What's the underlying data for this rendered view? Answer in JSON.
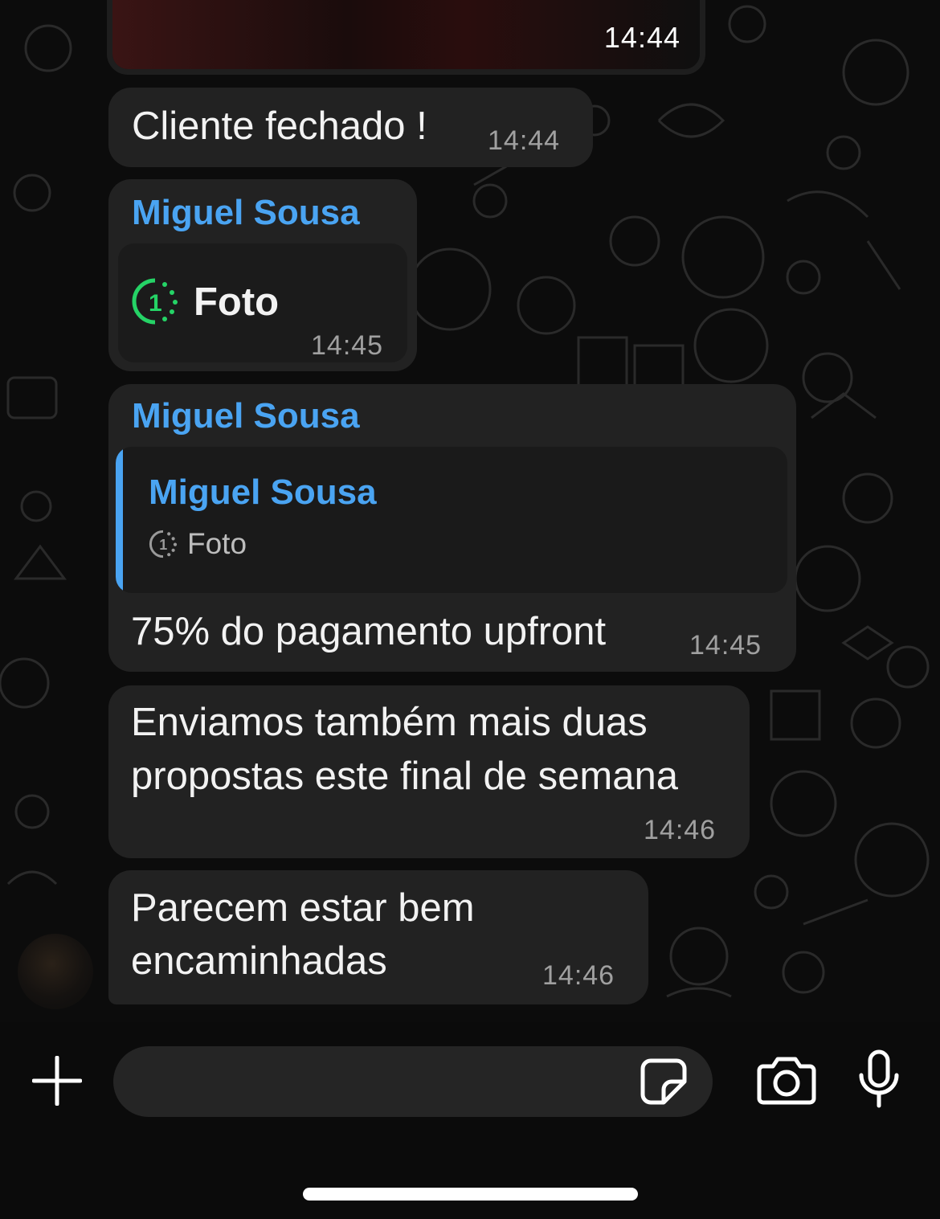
{
  "messages": {
    "media_time": "14:44",
    "msg1": {
      "text": "Cliente fechado !",
      "time": "14:44"
    },
    "msg2": {
      "sender": "Miguel Sousa",
      "media_label": "Foto",
      "time": "14:45"
    },
    "msg3": {
      "sender": "Miguel Sousa",
      "quote": {
        "sender": "Miguel Sousa",
        "label": "Foto"
      },
      "text": "75% do pagamento upfront",
      "time": "14:45"
    },
    "msg4": {
      "line1": "Enviamos também mais duas",
      "line2": "propostas este final de semana",
      "time": "14:46"
    },
    "msg5": {
      "line1": "Parecem estar bem",
      "line2": "encaminhadas",
      "time": "14:46"
    }
  },
  "composer": {
    "attach_icon": "plus-icon",
    "sticker_icon": "sticker-icon",
    "camera_icon": "camera-icon",
    "mic_icon": "microphone-icon",
    "input_value": ""
  },
  "colors": {
    "sender": "#4aa4f2",
    "view_once": "#25d366",
    "bubble": "#222222"
  }
}
